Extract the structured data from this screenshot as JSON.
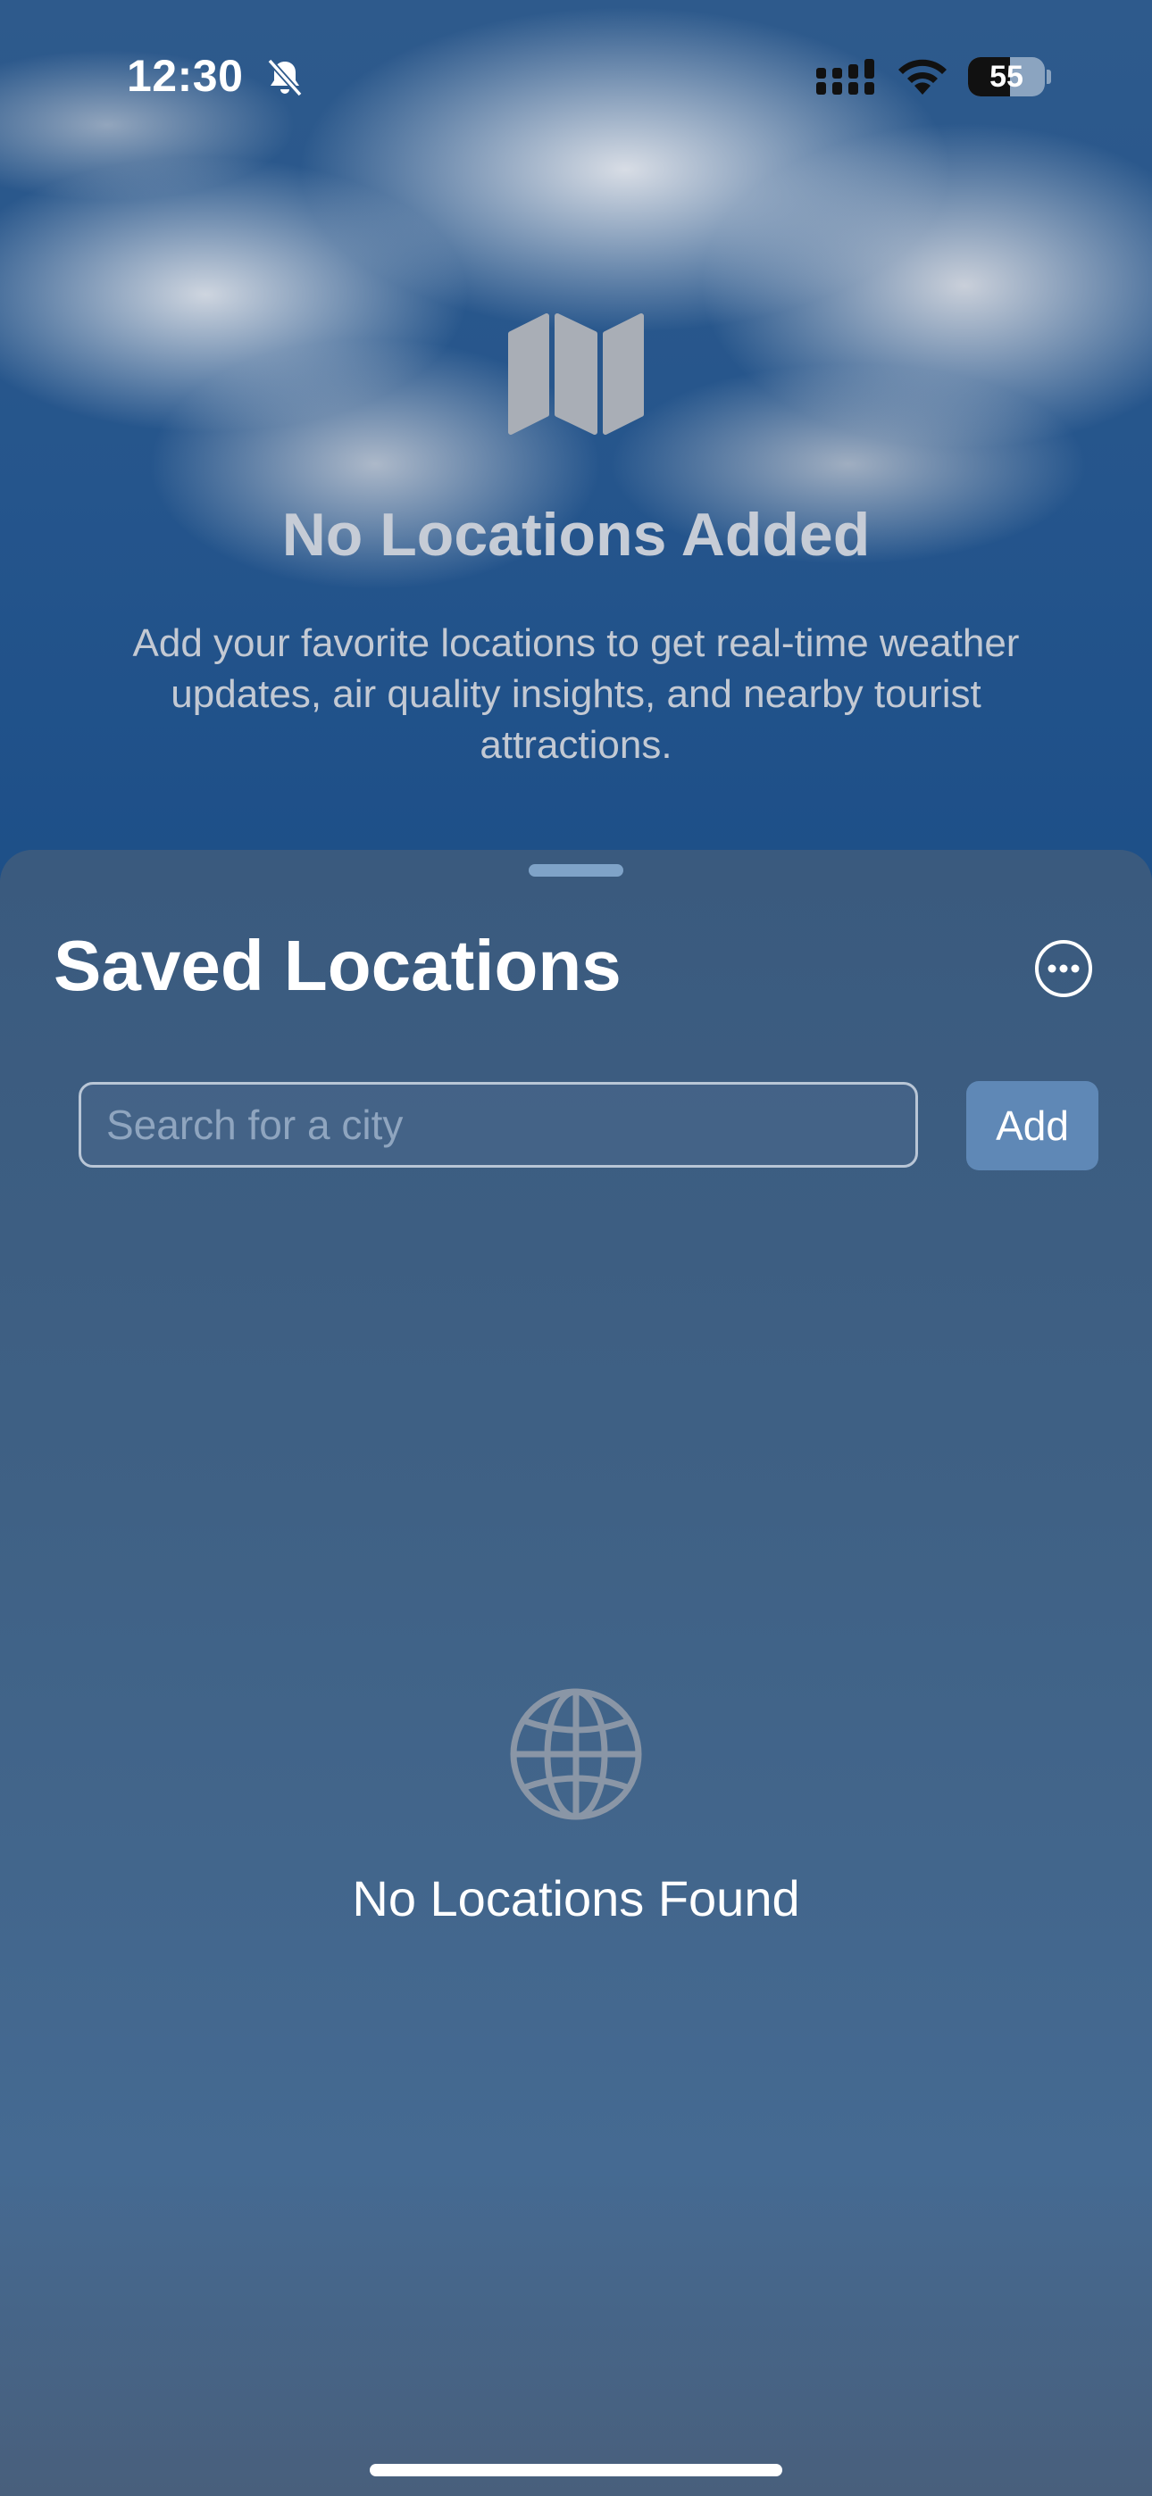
{
  "status_bar": {
    "time": "12:30",
    "battery_level": 55,
    "battery_text": "55"
  },
  "hero": {
    "icon": "map-icon",
    "title": "No Locations Added",
    "description": "Add your favorite locations to get real-time weather updates, air quality insights, and nearby tourist attractions."
  },
  "sheet": {
    "title": "Saved Locations",
    "more_icon": "ellipsis-circle-icon",
    "search": {
      "placeholder": "Search for a city",
      "value": ""
    },
    "add_label": "Add",
    "empty": {
      "icon": "globe-icon",
      "label": "No Locations Found"
    }
  },
  "colors": {
    "sheet_background": "#3f6185",
    "add_button": "#5f88b6",
    "grabber": "#7fa3c8",
    "text_primary": "#ffffff",
    "text_muted": "#c6ccd6"
  }
}
